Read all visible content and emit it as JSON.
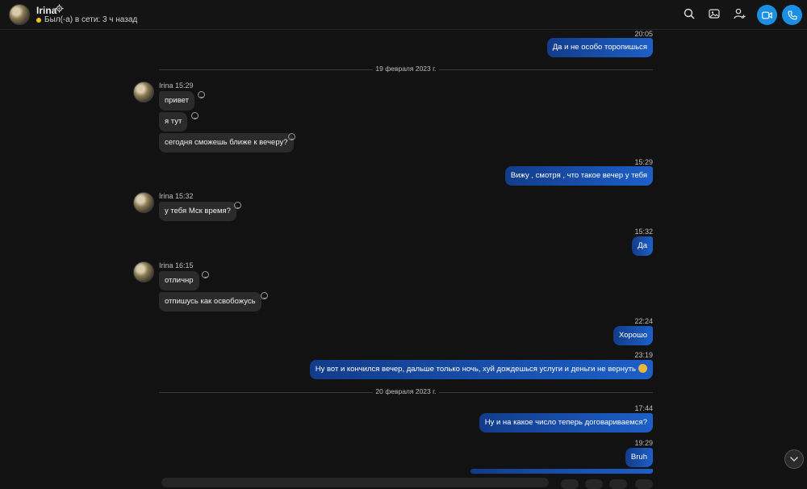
{
  "header": {
    "contact_name": "Irina",
    "status": "Был(-а) в сети: 3 ч назад",
    "status_color": "#f5c11a",
    "accent": "#1a8fe3",
    "icons": [
      "search-icon",
      "gallery-icon",
      "add-person-icon",
      "video-call-icon",
      "call-icon"
    ]
  },
  "chat": {
    "m1_time": "20:05",
    "m1_text": "Да и не особо торопишься",
    "date1": "19 февраля 2023 г.",
    "g1_sender": "Irina 15:29",
    "g1_msg1": "привет",
    "g1_msg2": "я тут",
    "g1_msg3": "сегодня сможешь ближе к вечеру?",
    "m2_time": "15:29",
    "m2_text": "Вижу , смотря , что такое вечер у тебя",
    "g2_sender": "Irina 15:32",
    "g2_msg1": "у тебя Мск время?",
    "m3_time": "15:32",
    "m3_text": "Да",
    "g3_sender": "Irina 16:15",
    "g3_msg1": "отличнр",
    "g3_msg2": "отпишусь как освобожусь",
    "m4_time": "22:24",
    "m4_text": "Хорошо",
    "m5_time": "23:19",
    "m5_text": "Ну вот и кончился вечер, дальше только ночь, хуй дождешься услуги и деньги не вернуть",
    "date2": "20 февраля 2023 г.",
    "m6_time": "17:44",
    "m6_text": "Ну и на какое число теперь договариваемся?",
    "m7_time": "19:29",
    "m7_text": "Bruh"
  }
}
